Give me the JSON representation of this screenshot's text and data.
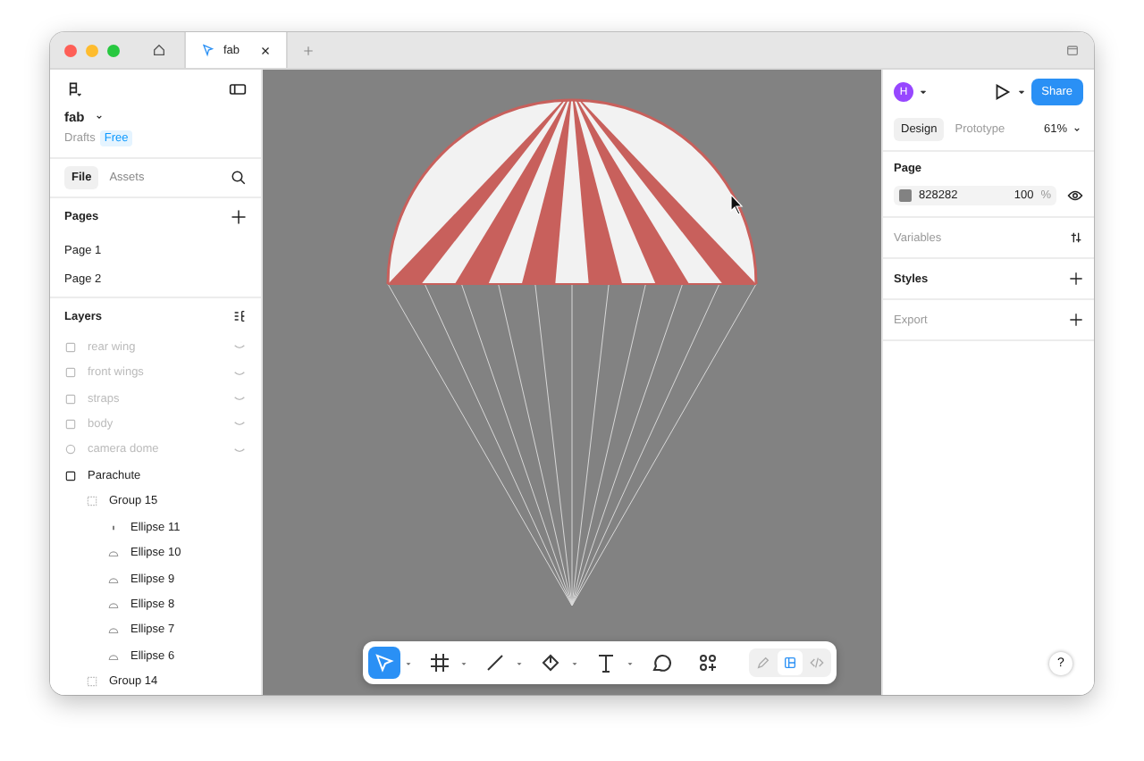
{
  "window": {
    "tabs": [
      {
        "kind": "home",
        "selected": false
      },
      {
        "kind": "file",
        "label": "fab",
        "selected": true
      }
    ]
  },
  "left_panel": {
    "file_name": "fab",
    "location": "Drafts",
    "plan": "Free",
    "tabs": [
      {
        "label": "File",
        "selected": true
      },
      {
        "label": "Assets",
        "selected": false
      }
    ],
    "pages": {
      "title": "Pages",
      "items": [
        {
          "label": "Page 1",
          "selected": false
        },
        {
          "label": "Page 2",
          "selected": false
        }
      ]
    },
    "layers": {
      "title": "Layers",
      "items": [
        {
          "name": "rear wing",
          "kind": "frame",
          "hidden": true
        },
        {
          "name": "front wings",
          "kind": "frame",
          "hidden": true
        },
        {
          "name": "straps",
          "kind": "frame",
          "hidden": true
        },
        {
          "name": "body",
          "kind": "frame",
          "hidden": true
        },
        {
          "name": "camera dome",
          "kind": "circle",
          "hidden": true
        },
        {
          "name": "Parachute",
          "kind": "frame",
          "hidden": false,
          "children": [
            {
              "name": "Group 15",
              "kind": "group",
              "hidden": false,
              "children": [
                {
                  "name": "Ellipse 11",
                  "kind": "dot",
                  "hidden": false
                },
                {
                  "name": "Ellipse 10",
                  "kind": "arc",
                  "hidden": false
                },
                {
                  "name": "Ellipse 9",
                  "kind": "arc",
                  "hidden": false
                },
                {
                  "name": "Ellipse 8",
                  "kind": "arc",
                  "hidden": false
                },
                {
                  "name": "Ellipse 7",
                  "kind": "arc",
                  "hidden": false
                },
                {
                  "name": "Ellipse 6",
                  "kind": "arc",
                  "hidden": false
                }
              ]
            },
            {
              "name": "Group 14",
              "kind": "group",
              "hidden": false
            }
          ]
        }
      ]
    }
  },
  "toolbar": {
    "tools": [
      {
        "kind": "move",
        "selected": true,
        "dropdown": true
      },
      {
        "kind": "frame",
        "selected": false,
        "dropdown": true
      },
      {
        "kind": "line",
        "selected": false,
        "dropdown": true
      },
      {
        "kind": "pen",
        "selected": false,
        "dropdown": true
      },
      {
        "kind": "text",
        "selected": false,
        "dropdown": true
      },
      {
        "kind": "comment",
        "selected": false,
        "dropdown": false
      },
      {
        "kind": "actions",
        "selected": false,
        "dropdown": false
      }
    ],
    "modes": [
      {
        "kind": "draw",
        "selected": false
      },
      {
        "kind": "design",
        "selected": true
      },
      {
        "kind": "dev",
        "selected": false
      }
    ]
  },
  "right_panel": {
    "avatar": "H",
    "share": "Share",
    "tabs": [
      {
        "label": "Design",
        "selected": true
      },
      {
        "label": "Prototype",
        "selected": false
      }
    ],
    "zoom": "61%",
    "page": {
      "title": "Page",
      "color": "#828282",
      "hex": "828282",
      "opacity": "100",
      "unit": "%"
    },
    "sections": [
      {
        "title": "Variables",
        "kind": "variables",
        "muted": true
      },
      {
        "title": "Styles",
        "kind": "add",
        "muted": false
      },
      {
        "title": "Export",
        "kind": "add",
        "muted": true
      }
    ],
    "help": "?"
  }
}
